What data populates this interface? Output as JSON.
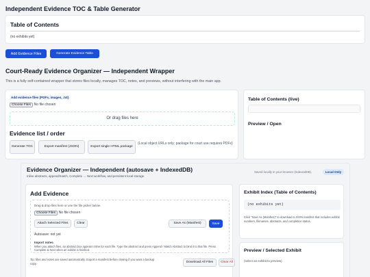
{
  "top": {
    "title": "Independent Evidence TOC & Table Generator",
    "toc_title": "Table of Contents",
    "toc_empty": "(no exhibits yet)",
    "add_button": "Add Evidence Files",
    "generate_table_button": "Generate Evidence Table"
  },
  "wrapper": {
    "title": "Court-Ready Evidence Organizer — Independent Wrapper",
    "description": "This is a fully self-contained wrapper that stores files locally, manages TOC, notes, and previews, without interfering with the main app.",
    "file_label": "Add evidence files (PDFs, images, .txt)",
    "choose_files": "Choose Files",
    "no_file": "No file chosen",
    "drop_text": "Or drag files here",
    "list_title": "Evidence list / order",
    "gen_toc": "Generate TOC",
    "export_manifest": "Export manifest (JSON)",
    "export_html": "Export single HTML package",
    "note": "(Local object URLs only; package for court use requires PDFs)",
    "toc_live_title": "Table of Contents (live)",
    "preview_title": "Preview / Open"
  },
  "organizer": {
    "title": "Evidence Organizer — Independent (autosave + IndexedDB)",
    "subtitle": "Inline abstracts, append/match, Complete → Next workflow, and persistent local storage.",
    "saved_note": "Saved locally in your browser (IndexedDB).",
    "badge": "Local Only",
    "add_title": "Add Evidence",
    "drop_hint": "Drag & drop files here or use the file picker below.",
    "choose_files": "Choose Files",
    "no_file": "No file chosen",
    "attach_selected": "Attach Selected Files",
    "clear": "Clear",
    "save_as_manifest": "Save As (Manifest)",
    "save": "Save",
    "autosave": "Autosave: not yet",
    "import_notes_title": "Import notes",
    "import_notes_text": "When you attach files, an abstract box appears inline for each file. Type the abstract and press Append / Match Abstract to bind it to that file. Press Complete & Next when an exhibit is finished.",
    "tip": "Tip: files and notes are saved automatically. Export a manifest before closing if you want a backup copy.",
    "download_all": "Download All Files",
    "clear_all": "Clear All",
    "exhibit_index_title": "Exhibit Index (Table of Contents)",
    "exhibit_empty": "(no exhibits yet)",
    "exhibit_help": "Click \"Save As (Manifest)\" to download a JSON manifest that includes exhibit numbers, filenames, abstracts, and completion status.",
    "preview_title": "Preview / Selected Exhibit",
    "preview_empty": "(select an exhibit to preview)"
  },
  "colors": {
    "primary": "#1d4ed8",
    "danger": "#dc2626",
    "badge_bg": "#dbeafe",
    "dropzone_border": "#a7f3d0"
  }
}
